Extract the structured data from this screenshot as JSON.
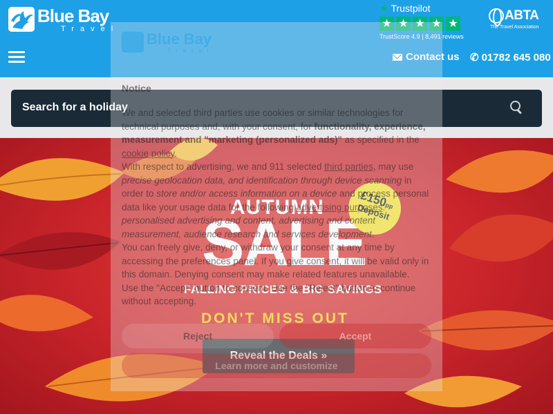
{
  "header": {
    "brand_name": "Blue Bay",
    "brand_sub": "Travel",
    "trustpilot": {
      "label": "Trustpilot",
      "score_text": "TrustScore 4.9",
      "reviews_text": "8,491 reviews",
      "stars": 5
    },
    "abta": {
      "name": "ABTA",
      "tagline": "The Travel Association"
    },
    "contact_label": "Contact us",
    "phone_label": "01782 645 080",
    "menu_icon": "hamburger-icon"
  },
  "search": {
    "label": "Search for a holiday",
    "icon": "search-icon"
  },
  "promo": {
    "headline_top": "AUTUMN",
    "headline_main": "SALE",
    "tagline": "FALLING PRICES & BIG SAVINGS",
    "cta_text": "DON'T MISS OUT",
    "deposit_amount": "£150",
    "deposit_unit": "pp",
    "deposit_label": "Deposit",
    "button_label": "Reveal the Deals »"
  },
  "cookie": {
    "heading": "Notice",
    "p1_a": "We and selected third parties use cookies or similar technologies for technical purposes and, with your consent, for ",
    "p1_b": "functionality, experience, measurement and \"marketing (personalized ads)\"",
    "p1_c": " as specified in the ",
    "cookie_policy_link": "cookie policy",
    "p2_a": "With respect to advertising, we and 911 selected ",
    "third_parties_link": "third parties",
    "p2_b": ", may use ",
    "p2_c": "precise geolocation data, and identification through device scanning",
    "p2_d": " in order to ",
    "p2_e": "store and/or access information on a device",
    "p2_f": " and process personal data like your usage data for the following ",
    "advertising_purposes_link": "advertising purposes",
    "p2_g": ": ",
    "p2_h": "personalised advertising and content, advertising and content measurement, audience research and services development",
    "p3": "You can freely give, deny, or withdraw your consent at any time by accessing the preferences panel. If you give consent, it will be valid only in this domain. Denying consent may make related features unavailable.",
    "p4": "Use the \"Accept\" button to consent. Use the \"Reject\" button to continue without accepting.",
    "reject_label": "Reject",
    "accept_label": "Accept",
    "learn_more_label": "Learn more and customize"
  },
  "colors": {
    "brand_blue": "#1ea0e6",
    "search_dark": "#1a2a36",
    "sale_red": "#c8242a",
    "trustpilot_green": "#00b67a",
    "deposit_yellow": "#f3e233",
    "cta_yellow": "#f7d21c"
  }
}
